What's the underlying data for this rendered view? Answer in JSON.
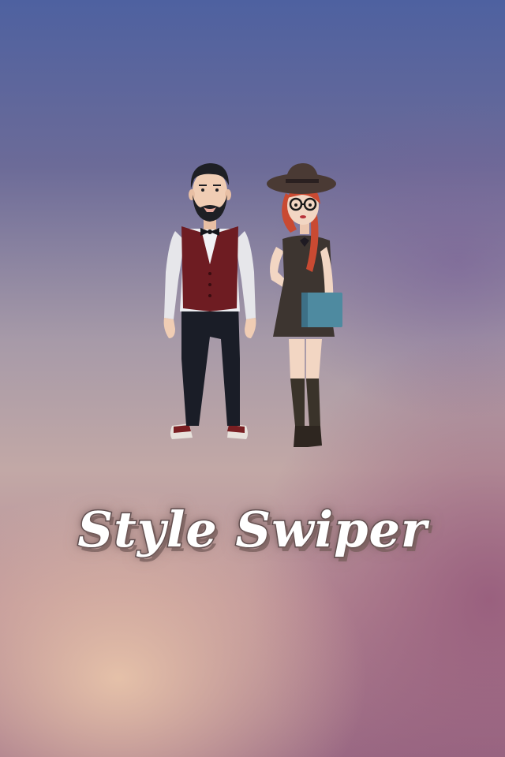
{
  "app": {
    "title": "Style Swiper"
  },
  "colors": {
    "background_top": "#4e61a0",
    "background_bottom_left": "#e8c4aa",
    "background_bottom_right": "#94587a",
    "title_fill": "#ffffff",
    "title_outline": "#5a4a4c"
  },
  "illustration": {
    "figures": [
      "man-figure",
      "woman-figure"
    ]
  }
}
